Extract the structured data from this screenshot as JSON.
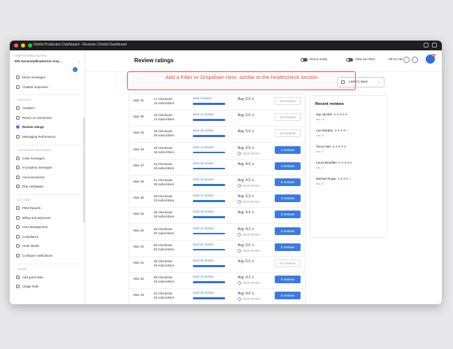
{
  "window": {
    "title": "Direful Production Dashboard - Reviews | Direful Dashboard"
  },
  "sidebar": {
    "org_small": "HAMPTON INN & SUITES",
    "org_name": "909 Sarasota/Bradenton-Airp...",
    "items_top": [
      {
        "label": "Direct messages",
        "icon": "message-icon"
      },
      {
        "label": "Chatbot responses",
        "icon": "chatbot-icon"
      }
    ],
    "sections": [
      {
        "title": "REPORTS",
        "items": [
          {
            "label": "Analytics",
            "icon": "chart-icon"
          },
          {
            "label": "Return on investment",
            "icon": "roi-icon"
          },
          {
            "label": "Review ratings",
            "icon": "star-icon",
            "active": true
          },
          {
            "label": "Messaging Performance",
            "icon": "performance-icon"
          }
        ]
      },
      {
        "title": "AUTOMATED MESSAGES",
        "items": [
          {
            "label": "Invite messages",
            "icon": "invite-icon"
          },
          {
            "label": "In-property messages",
            "icon": "property-icon"
          },
          {
            "label": "Announcements",
            "icon": "megaphone-icon"
          },
          {
            "label": "Drip campaigns",
            "icon": "drip-icon"
          }
        ]
      },
      {
        "title": "ACCOUNT",
        "items": [
          {
            "label": "PMS Reports",
            "icon": "report-icon"
          },
          {
            "label": "Billing and payments",
            "icon": "billing-icon"
          },
          {
            "label": "User Management",
            "icon": "users-icon"
          },
          {
            "label": "Compliance",
            "icon": "compliance-icon"
          },
          {
            "label": "Hotel details",
            "icon": "hotel-icon"
          },
          {
            "label": "Configure notifications",
            "icon": "bell-icon"
          }
        ]
      },
      {
        "title": "ADMIN",
        "items": [
          {
            "label": "Add guest data",
            "icon": "upload-icon"
          },
          {
            "label": "Usage stats",
            "icon": "stats-icon"
          }
        ]
      }
    ]
  },
  "header": {
    "title": "Review ratings",
    "demo_mode": "Demo mode",
    "view_as_client": "View as client",
    "time": "05:41 AM",
    "notification_count": "10"
  },
  "note": "Add a Filter or Dropdown here, similar to the healthcheck section",
  "date_range": {
    "label": "Last 11 days"
  },
  "rows": [
    {
      "date": "Mar 31",
      "checkouts": "17 checkouts",
      "subscribers": "15 subscribers",
      "invites": "Sent 0 invites",
      "avg": "Avg. 0.0",
      "attention": "",
      "reviews": "No reviews",
      "has_reviews": false
    },
    {
      "date": "Mar 30",
      "checkouts": "19 checkouts",
      "subscribers": "14 subscribers",
      "invites": "Sent 12 invites",
      "avg": "Avg. 0.0",
      "attention": "",
      "reviews": "No reviews",
      "has_reviews": false
    },
    {
      "date": "Mar 29",
      "checkouts": "35 checkouts",
      "subscribers": "30 subscribers",
      "invites": "Sent 18 invites",
      "avg": "Avg. 0.0",
      "attention": "",
      "reviews": "No reviews",
      "has_reviews": false
    },
    {
      "date": "Mar 28",
      "checkouts": "28 checkouts",
      "subscribers": "16 subscribers",
      "invites": "Sent 14 invites",
      "avg": "Avg. 3.5",
      "attention": "Needs attention",
      "reviews": "4 reviews",
      "has_reviews": true
    },
    {
      "date": "Mar 27",
      "checkouts": "42 checkouts",
      "subscribers": "29 subscribers",
      "invites": "Sent 28 invites",
      "avg": "Avg. 4.5",
      "attention": "",
      "reviews": "4 reviews",
      "has_reviews": true
    },
    {
      "date": "Mar 26",
      "checkouts": "41 checkouts",
      "subscribers": "35 subscribers",
      "invites": "Sent 32 invites",
      "avg": "Avg. 4.2",
      "attention": "Needs attention",
      "reviews": "6 reviews",
      "has_reviews": true
    },
    {
      "date": "Mar 25",
      "checkouts": "48 checkouts",
      "subscribers": "33 subscribers",
      "invites": "Sent 31 invites",
      "avg": "Avg. 3.3",
      "attention": "Needs attention",
      "reviews": "3 reviews",
      "has_reviews": true
    },
    {
      "date": "Mar 24",
      "checkouts": "35 checkouts",
      "subscribers": "28 subscribers",
      "invites": "Sent 26 invites",
      "avg": "Avg. 4.5",
      "attention": "",
      "reviews": "2 reviews",
      "has_reviews": true
    },
    {
      "date": "Mar 23",
      "checkouts": "26 checkouts",
      "subscribers": "20 subscribers",
      "invites": "Sent 23 invites",
      "avg": "Avg. 4.3",
      "attention": "Needs attention",
      "reviews": "4 reviews",
      "has_reviews": true
    },
    {
      "date": "Mar 22",
      "checkouts": "60 checkouts",
      "subscribers": "53 subscribers",
      "invites": "Sent 51 invites",
      "avg": "Avg. 3.6",
      "attention": "Needs attention",
      "reviews": "8 reviews",
      "has_reviews": true
    },
    {
      "date": "Mar 21",
      "checkouts": "30 checkouts",
      "subscribers": "25 subscribers",
      "invites": "Sent 20 invites",
      "avg": "Avg. 0.0",
      "attention": "",
      "reviews": "No reviews",
      "has_reviews": false
    },
    {
      "date": "Mar 20",
      "checkouts": "56 checkouts",
      "subscribers": "45 subscribers",
      "invites": "Sent 41 invites",
      "avg": "Avg. 4.2",
      "attention": "Needs attention",
      "reviews": "6 reviews",
      "has_reviews": true
    },
    {
      "date": "Mar 19",
      "checkouts": "52 checkouts",
      "subscribers": "45 subscribers",
      "invites": "Sent 35 invites",
      "avg": "Avg. 4.0",
      "attention": "Needs attention",
      "reviews": "6 reviews",
      "has_reviews": true
    }
  ],
  "recent_reviews": {
    "title": "Recent reviews",
    "items": [
      {
        "name": "Jay Jacobs",
        "rating": 5,
        "date": "Mar 28"
      },
      {
        "name": "Lee Murphy",
        "rating": 4,
        "date": "Mar 28"
      },
      {
        "name": "Tricia Hart",
        "rating": 5,
        "date": "Mar 27"
      },
      {
        "name": "Laura Beadles",
        "rating": 5,
        "date": "Mar 27"
      },
      {
        "name": "Michael Rupp",
        "rating": 4,
        "date": "Mar 27"
      }
    ]
  },
  "colors": {
    "accent": "#3b7be0",
    "star": "#4caf50",
    "note_border": "#e0505a",
    "notification": "#f06a35"
  }
}
